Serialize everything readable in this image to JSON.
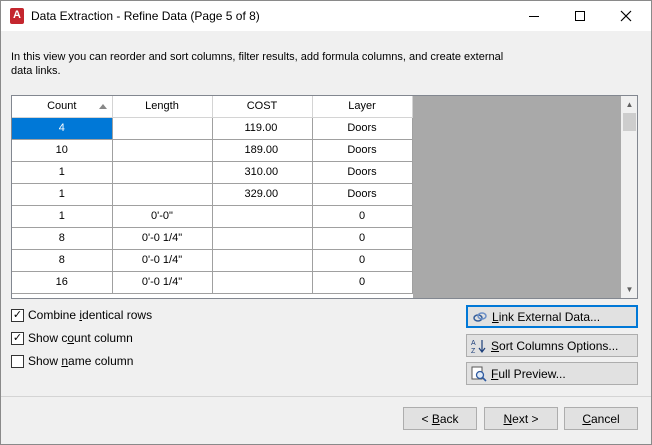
{
  "window": {
    "title": "Data Extraction - Refine Data (Page 5 of 8)",
    "app_icon_letter": "A"
  },
  "intro": "In this view you can reorder and sort columns, filter results, add formula columns, and create external data links.",
  "grid": {
    "columns": [
      "Count",
      "Length",
      "COST",
      "Layer"
    ],
    "rows": [
      [
        "4",
        "",
        "119.00",
        "Doors"
      ],
      [
        "10",
        "",
        "189.00",
        "Doors"
      ],
      [
        "1",
        "",
        "310.00",
        "Doors"
      ],
      [
        "1",
        "",
        "329.00",
        "Doors"
      ],
      [
        "1",
        "0'-0\"",
        "",
        "0"
      ],
      [
        "8",
        "0'-0 1/4\"",
        "",
        "0"
      ],
      [
        "8",
        "0'-0 1/4\"",
        "",
        "0"
      ],
      [
        "16",
        "0'-0 1/4\"",
        "",
        "0"
      ]
    ]
  },
  "options": {
    "combine": {
      "pre": "Combine ",
      "acc": "i",
      "post": "dentical rows",
      "checked": true
    },
    "count": {
      "pre": "Show c",
      "acc": "o",
      "post": "unt column",
      "checked": true
    },
    "name": {
      "pre": "Show ",
      "acc": "n",
      "post": "ame column",
      "checked": false
    }
  },
  "buttons": {
    "link": {
      "acc": "L",
      "post": "ink External Data..."
    },
    "sort": {
      "acc": "S",
      "post": "ort Columns Options..."
    },
    "preview": {
      "acc": "F",
      "post": "ull Preview..."
    },
    "back": {
      "pre": "< ",
      "acc": "B",
      "post": "ack"
    },
    "next": {
      "acc": "N",
      "post": "ext >"
    },
    "cancel": {
      "acc": "C",
      "post": "ancel"
    }
  },
  "colors": {
    "selection": "#0078d7",
    "app_icon": "#c4262e"
  }
}
